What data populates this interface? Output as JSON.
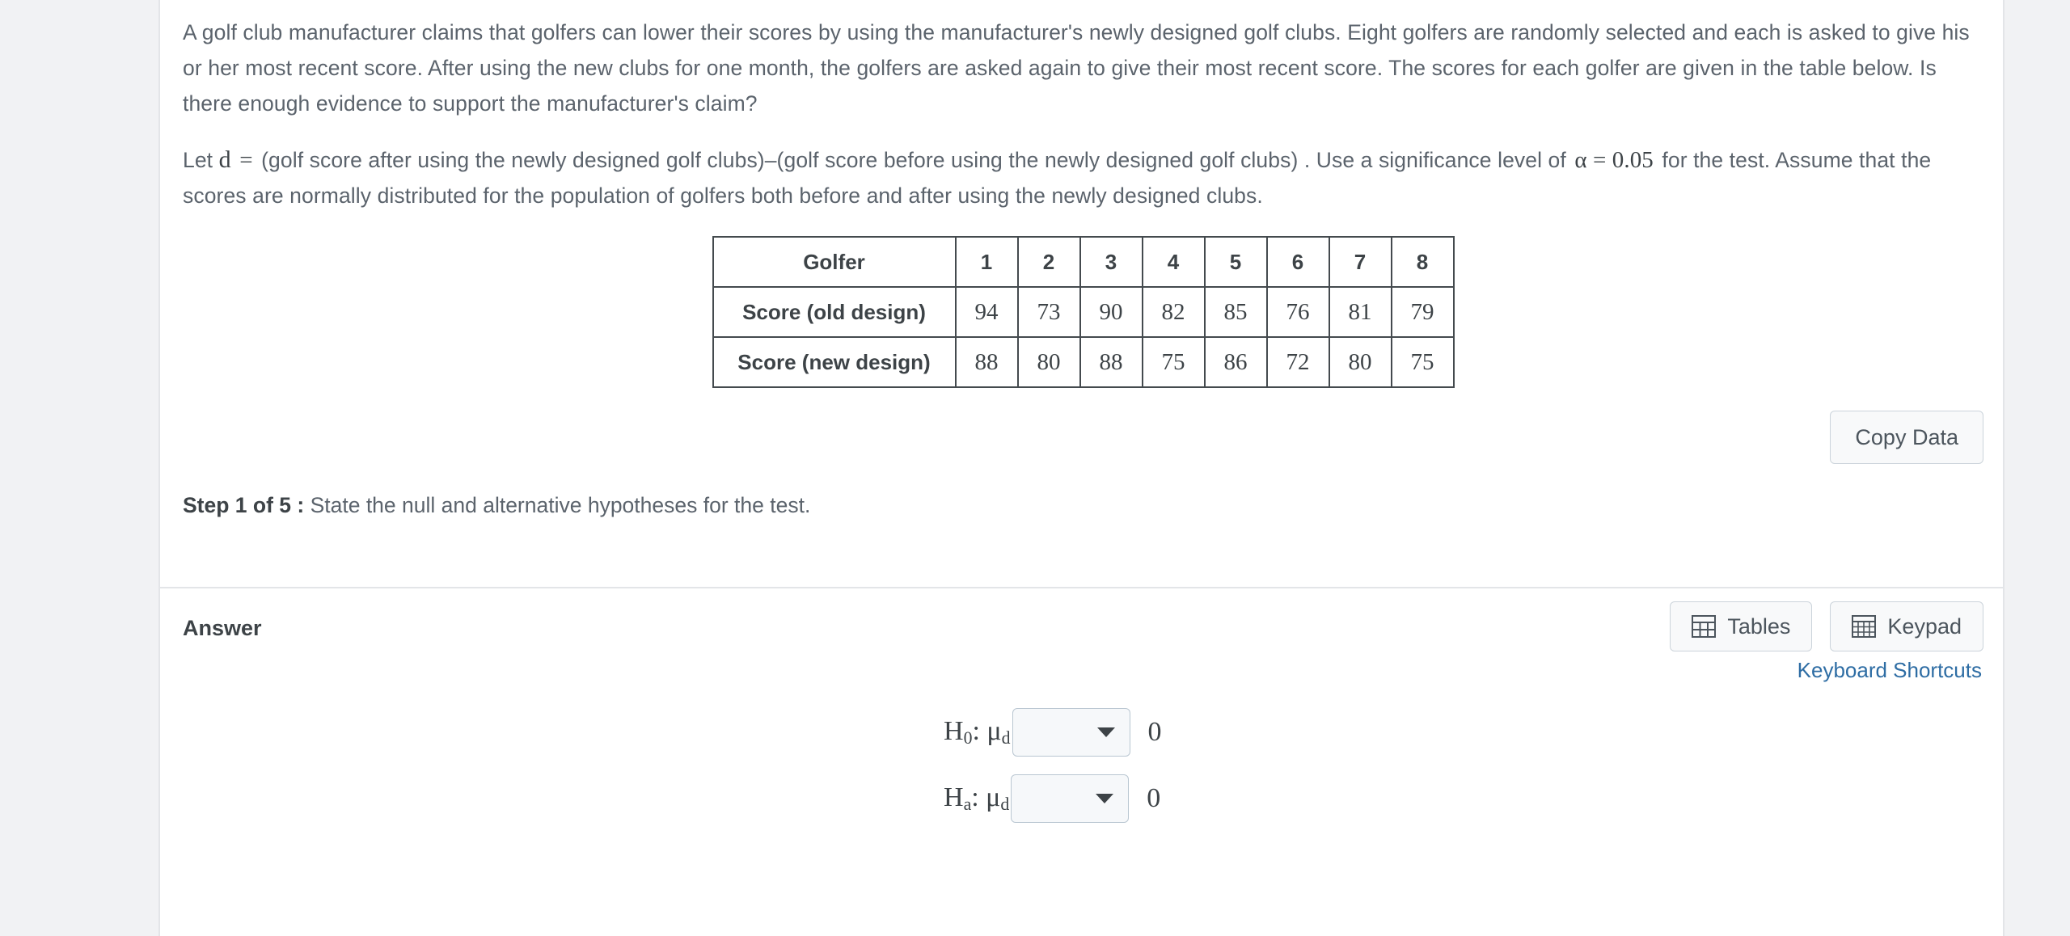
{
  "problem": {
    "paragraph1": "A golf club manufacturer claims that golfers can lower their scores by using the manufacturer's newly designed golf clubs.  Eight golfers are randomly selected and each is asked to give his or her most recent score.  After using the new clubs for one month, the golfers are asked again to give their most recent score.  The scores for each golfer are given in the table below.  Is there enough evidence to support the manufacturer's claim?",
    "paragraph2_pre": "Let",
    "paragraph2_var": "d",
    "paragraph2_eq": "=",
    "paragraph2_def": "(golf score after using the newly designed golf clubs)–(golf score before using the newly designed golf clubs) .  Use a significance level of",
    "paragraph2_alpha": "α  =  0.05",
    "paragraph2_post": "for the test. Assume that the scores are normally distributed for the population of golfers both before and after using the newly designed clubs."
  },
  "table": {
    "row_labels": [
      "Golfer",
      "Score (old design)",
      "Score (new design)"
    ],
    "golfers": [
      "1",
      "2",
      "3",
      "4",
      "5",
      "6",
      "7",
      "8"
    ],
    "old_design": [
      "94",
      "73",
      "90",
      "82",
      "85",
      "76",
      "81",
      "79"
    ],
    "new_design": [
      "88",
      "80",
      "88",
      "75",
      "86",
      "72",
      "80",
      "75"
    ]
  },
  "copy_data_label": "Copy Data",
  "step": {
    "prefix": "Step 1 of 5 :",
    "text": "State the null and alternative hypotheses for the test."
  },
  "answer": {
    "label": "Answer",
    "tables_button": "Tables",
    "keypad_button": "Keypad",
    "keyboard_shortcuts": "Keyboard Shortcuts",
    "hypotheses": [
      {
        "name": "H",
        "sub": "0",
        "mu": "μ",
        "musub": "d",
        "dropdown_value": "",
        "value": "0"
      },
      {
        "name": "H",
        "sub": "a",
        "mu": "μ",
        "musub": "d",
        "dropdown_value": "",
        "value": "0"
      }
    ]
  },
  "colors": {
    "page_background": "#f1f2f4",
    "card_background": "#ffffff",
    "body_text": "#5b636c",
    "heading_text": "#3d4347",
    "link": "#2e6da4",
    "table_border": "#444a4e",
    "button_border": "#ccd4db",
    "dropdown_border": "#b9c6d1"
  }
}
